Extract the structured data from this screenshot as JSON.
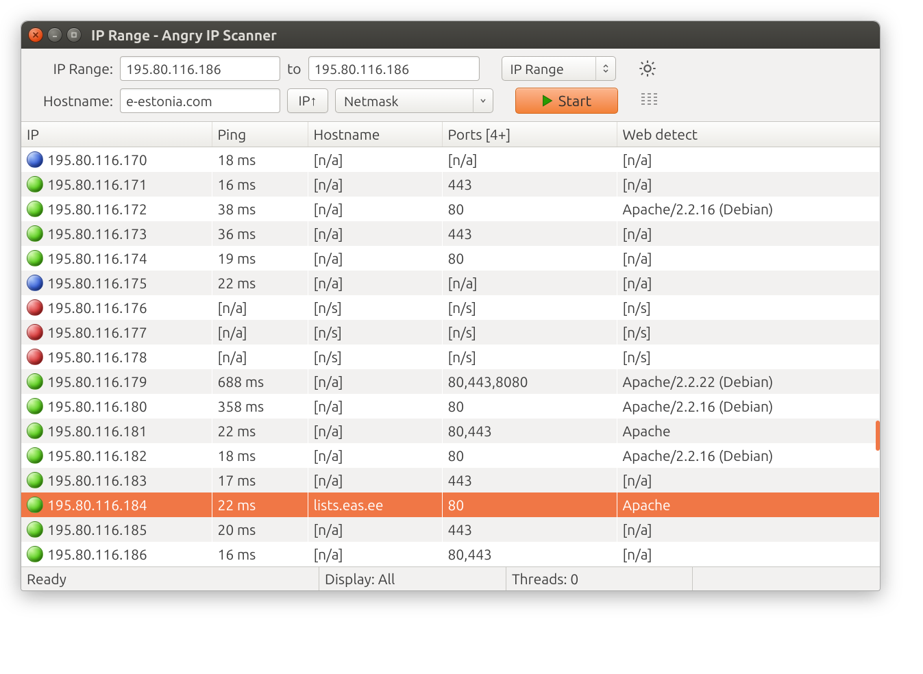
{
  "window": {
    "title": "IP Range - Angry IP Scanner"
  },
  "toolbar": {
    "ip_range_label": "IP Range:",
    "ip_start": "195.80.116.186",
    "to_label": "to",
    "ip_end": "195.80.116.186",
    "mode_selector": "IP Range",
    "hostname_label": "Hostname:",
    "hostname": "e-estonia.com",
    "ip_up_label": "IP↑",
    "netmask_label": "Netmask",
    "start_label": "Start"
  },
  "columns": {
    "ip": "IP",
    "ping": "Ping",
    "hostname": "Hostname",
    "ports": "Ports [4+]",
    "web": "Web detect"
  },
  "rows": [
    {
      "status": "blue",
      "ip": "195.80.116.170",
      "ping": "18 ms",
      "host": "[n/a]",
      "ports": "[n/a]",
      "web": "[n/a]",
      "selected": false
    },
    {
      "status": "green",
      "ip": "195.80.116.171",
      "ping": "16 ms",
      "host": "[n/a]",
      "ports": "443",
      "web": "[n/a]",
      "selected": false
    },
    {
      "status": "green",
      "ip": "195.80.116.172",
      "ping": "38 ms",
      "host": "[n/a]",
      "ports": "80",
      "web": "Apache/2.2.16 (Debian)",
      "selected": false
    },
    {
      "status": "green",
      "ip": "195.80.116.173",
      "ping": "36 ms",
      "host": "[n/a]",
      "ports": "443",
      "web": "[n/a]",
      "selected": false
    },
    {
      "status": "green",
      "ip": "195.80.116.174",
      "ping": "19 ms",
      "host": "[n/a]",
      "ports": "80",
      "web": "[n/a]",
      "selected": false
    },
    {
      "status": "blue",
      "ip": "195.80.116.175",
      "ping": "22 ms",
      "host": "[n/a]",
      "ports": "[n/a]",
      "web": "[n/a]",
      "selected": false
    },
    {
      "status": "red",
      "ip": "195.80.116.176",
      "ping": "[n/a]",
      "host": "[n/s]",
      "ports": "[n/s]",
      "web": "[n/s]",
      "selected": false
    },
    {
      "status": "red",
      "ip": "195.80.116.177",
      "ping": "[n/a]",
      "host": "[n/s]",
      "ports": "[n/s]",
      "web": "[n/s]",
      "selected": false
    },
    {
      "status": "red",
      "ip": "195.80.116.178",
      "ping": "[n/a]",
      "host": "[n/s]",
      "ports": "[n/s]",
      "web": "[n/s]",
      "selected": false
    },
    {
      "status": "green",
      "ip": "195.80.116.179",
      "ping": "688 ms",
      "host": "[n/a]",
      "ports": "80,443,8080",
      "web": "Apache/2.2.22 (Debian)",
      "selected": false
    },
    {
      "status": "green",
      "ip": "195.80.116.180",
      "ping": "358 ms",
      "host": "[n/a]",
      "ports": "80",
      "web": "Apache/2.2.16 (Debian)",
      "selected": false
    },
    {
      "status": "green",
      "ip": "195.80.116.181",
      "ping": "22 ms",
      "host": "[n/a]",
      "ports": "80,443",
      "web": "Apache",
      "selected": false
    },
    {
      "status": "green",
      "ip": "195.80.116.182",
      "ping": "18 ms",
      "host": "[n/a]",
      "ports": "80",
      "web": "Apache/2.2.16 (Debian)",
      "selected": false
    },
    {
      "status": "green",
      "ip": "195.80.116.183",
      "ping": "17 ms",
      "host": "[n/a]",
      "ports": "443",
      "web": "[n/a]",
      "selected": false
    },
    {
      "status": "green",
      "ip": "195.80.116.184",
      "ping": "22 ms",
      "host": "lists.eas.ee",
      "ports": "80",
      "web": "Apache",
      "selected": true
    },
    {
      "status": "green",
      "ip": "195.80.116.185",
      "ping": "20 ms",
      "host": "[n/a]",
      "ports": "443",
      "web": "[n/a]",
      "selected": false
    },
    {
      "status": "green",
      "ip": "195.80.116.186",
      "ping": "16 ms",
      "host": "[n/a]",
      "ports": "80,443",
      "web": "[n/a]",
      "selected": false
    }
  ],
  "statusbar": {
    "ready": "Ready",
    "display": "Display: All",
    "threads": "Threads: 0"
  }
}
